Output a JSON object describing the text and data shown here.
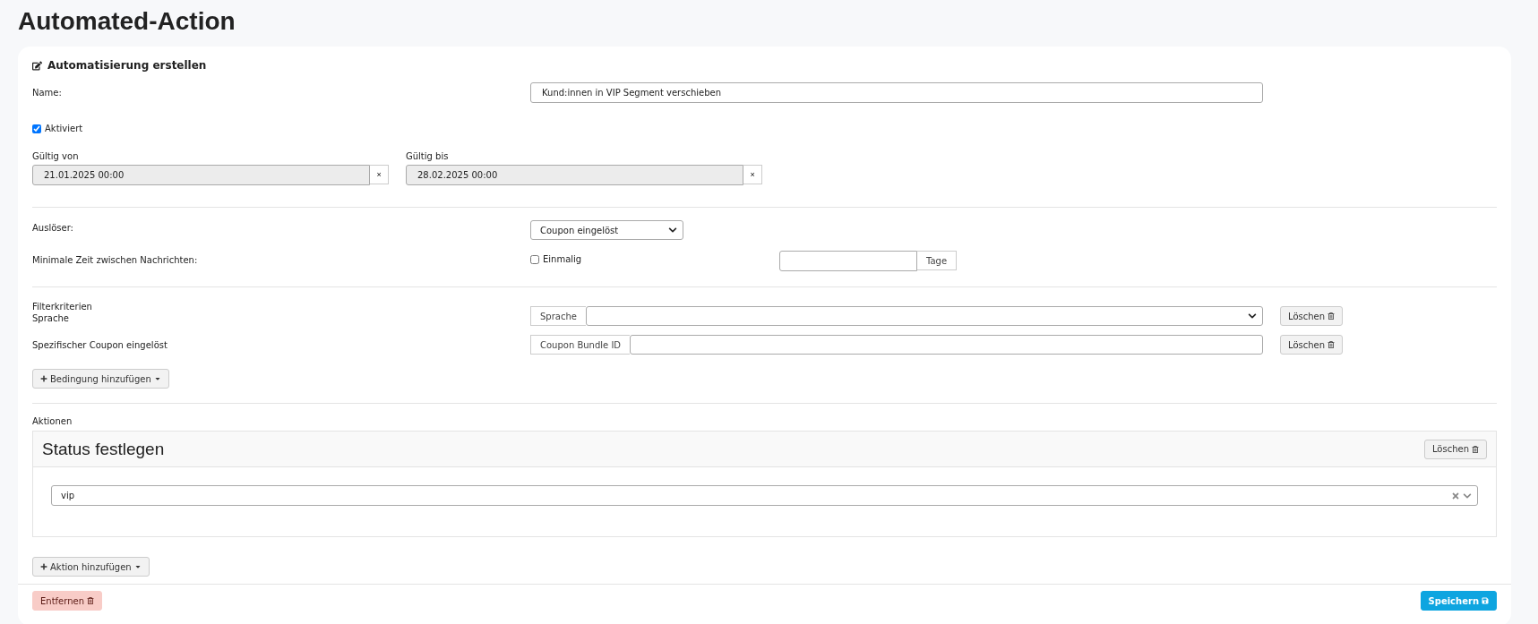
{
  "page_title": "Automated-Action",
  "card_title": "Automatisierung erstellen",
  "name": {
    "label": "Name:",
    "value": "Kund:innen in VIP Segment verschieben"
  },
  "active": {
    "label": "Aktiviert",
    "checked": true
  },
  "valid_from": {
    "label": "Gültig von",
    "value": "21.01.2025 00:00",
    "clear": "×"
  },
  "valid_to": {
    "label": "Gültig bis",
    "value": "28.02.2025 00:00",
    "clear": "×"
  },
  "trigger": {
    "label": "Auslöser:",
    "value": "Coupon eingelöst"
  },
  "min_time": {
    "label": "Minimale Zeit zwischen Nachrichten:",
    "once_label": "Einmalig",
    "once_checked": false,
    "unit": "Tage"
  },
  "filters": {
    "title": "Filterkriterien",
    "items": [
      {
        "label": "Sprache",
        "kind": "select",
        "addon": "Sprache",
        "delete": "Löschen"
      },
      {
        "label": "Spezifischer Coupon eingelöst",
        "kind": "input",
        "addon": "Coupon Bundle ID",
        "delete": "Löschen"
      }
    ],
    "add": "Bedingung hinzufügen"
  },
  "actions": {
    "title": "Aktionen",
    "items": [
      {
        "title": "Status festlegen",
        "delete": "Löschen",
        "value": "vip"
      }
    ],
    "add": "Aktion hinzufügen"
  },
  "footer": {
    "remove": "Entfernen",
    "save": "Speichern"
  }
}
